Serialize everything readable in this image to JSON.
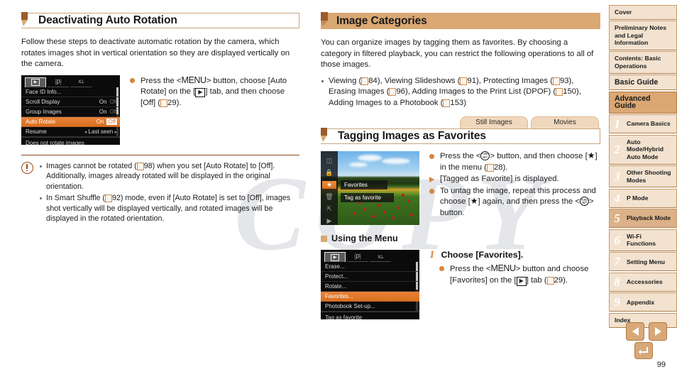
{
  "page_number": "99",
  "colors": {
    "accent": "#d9833a",
    "header_fill": "#d9a873",
    "sidebar_bg": "#f2e2cf",
    "sidebar_active": "#dba772",
    "rule": "#8a4a1e",
    "menu_highlight": "#d9701f"
  },
  "left_column": {
    "section": {
      "title": "Deactivating Auto Rotation",
      "intro": "Follow these steps to deactivate automatic rotation by the camera, which rotates images shot in vertical orientation so they are displayed vertically on the camera."
    },
    "camera_screen": {
      "tabs": [
        "playback-tab",
        "print-tab",
        "settings-tab"
      ],
      "rows": [
        {
          "label": "Face ID Info...",
          "value": "",
          "value2": "",
          "selected": false
        },
        {
          "label": "Scroll Display",
          "value": "On",
          "value2": "Off",
          "selected": false
        },
        {
          "label": "Group Images",
          "value": "On",
          "value2": "Off",
          "selected": false
        },
        {
          "label": "Auto Rotate",
          "value": "On",
          "value2": "Off",
          "selected": true
        },
        {
          "label": "Resume",
          "value": "Last seen",
          "value2": "",
          "selected": false,
          "arrows": true
        }
      ],
      "footer": "Does not rotate images"
    },
    "instructions": [
      {
        "marker": "dot",
        "segments": [
          {
            "t": "Press the <"
          },
          {
            "t": "MENU",
            "k": "menu"
          },
          {
            "t": "> button, choose [Auto Rotate] on the ["
          },
          {
            "t": "",
            "k": "playback"
          },
          {
            "t": "] tab, and then choose [Off] ("
          },
          {
            "t": "",
            "k": "book"
          },
          {
            "t": "29)."
          }
        ]
      }
    ],
    "notes": [
      "Images cannot be rotated (@98) when you set [Auto Rotate] to [Off]. Additionally, images already rotated will be displayed in the original orientation.",
      "In Smart Shuffle (@92) mode, even if [Auto Rotate] is set to [Off], images shot vertically will be displayed vertically, and rotated images will be displayed in the rotated orientation."
    ],
    "note_refs": [
      "98",
      "92"
    ]
  },
  "right_column": {
    "section": {
      "title": "Image Categories",
      "intro": "You can organize images by tagging them as favorites. By choosing a category in filtered playback, you can restrict the following operations to all of those images.",
      "bullet": "Viewing (@84), Viewing Slideshows (@91), Protecting Images (@93), Erasing Images (@96), Adding Images to the Print List (DPOF) (@150), Adding Images to a Photobook (@153)",
      "bullet_refs": [
        "84",
        "91",
        "93",
        "96",
        "150",
        "153"
      ]
    },
    "applicability_tabs": [
      "Still Images",
      "Movies"
    ],
    "subsection": {
      "title": "Tagging Images as Favorites"
    },
    "favorites_screen": {
      "menu_items": [
        "rotate-icon",
        "protect-icon",
        "favorites-star-icon",
        "erase-icon",
        "transfer-icon",
        "slideshow-icon"
      ],
      "selected_label": "Favorites",
      "description": "Tag as favorite"
    },
    "instructions": [
      {
        "marker": "dot",
        "text_parts": [
          "Press the <",
          "FUNC-SET",
          "> button, and then choose [",
          "star",
          "] in the menu (",
          "book",
          "28)."
        ]
      },
      {
        "marker": "triangle",
        "text": "[Tagged as Favorite] is displayed."
      },
      {
        "marker": "dot",
        "text_parts": [
          "To untag the image, repeat this process and choose [",
          "star",
          "] again, and then press the <",
          "FUNC-SET",
          "> button."
        ]
      }
    ],
    "menu_subhead": "Using the Menu",
    "menu_screen": {
      "tabs": [
        "playback-tab",
        "print-tab",
        "settings-tab"
      ],
      "rows": [
        {
          "label": "Erase...",
          "selected": false
        },
        {
          "label": "Protect...",
          "selected": false
        },
        {
          "label": "Rotate...",
          "selected": false
        },
        {
          "label": "Favorites...",
          "selected": true
        },
        {
          "label": "Photobook Set-up...",
          "selected": false
        }
      ],
      "footer": "Tag as favorite"
    },
    "step": {
      "number": "1",
      "title": "Choose [Favorites].",
      "instruction_parts": [
        "Press the <",
        "MENU",
        "> button and choose [Favorites] on the [",
        "playback",
        "] tab (",
        "book",
        "29)."
      ]
    }
  },
  "sidebar": {
    "items": [
      {
        "label": "Cover",
        "style": "plain"
      },
      {
        "label": "Preliminary Notes and Legal Information",
        "style": "plain"
      },
      {
        "label": "Contents: Basic Operations",
        "style": "plain"
      },
      {
        "label": "Basic Guide",
        "style": "big"
      },
      {
        "label": "Advanced Guide",
        "style": "big-active"
      },
      {
        "label": "Camera Basics",
        "num": "1",
        "style": "numbered"
      },
      {
        "label": "Auto Mode/Hybrid Auto Mode",
        "num": "2",
        "style": "numbered"
      },
      {
        "label": "Other Shooting Modes",
        "num": "3",
        "style": "numbered"
      },
      {
        "label": "P Mode",
        "num": "4",
        "style": "numbered"
      },
      {
        "label": "Playback Mode",
        "num": "5",
        "style": "numbered-selected"
      },
      {
        "label": "Wi-Fi Functions",
        "num": "6",
        "style": "numbered"
      },
      {
        "label": "Setting Menu",
        "num": "7",
        "style": "numbered"
      },
      {
        "label": "Accessories",
        "num": "8",
        "style": "numbered"
      },
      {
        "label": "Appendix",
        "num": "9",
        "style": "numbered"
      },
      {
        "label": "Index",
        "style": "plain"
      }
    ]
  },
  "footer_nav": {
    "prev_label": "◀",
    "next_label": "▶",
    "home_label": "↰"
  },
  "watermark": "COPY"
}
